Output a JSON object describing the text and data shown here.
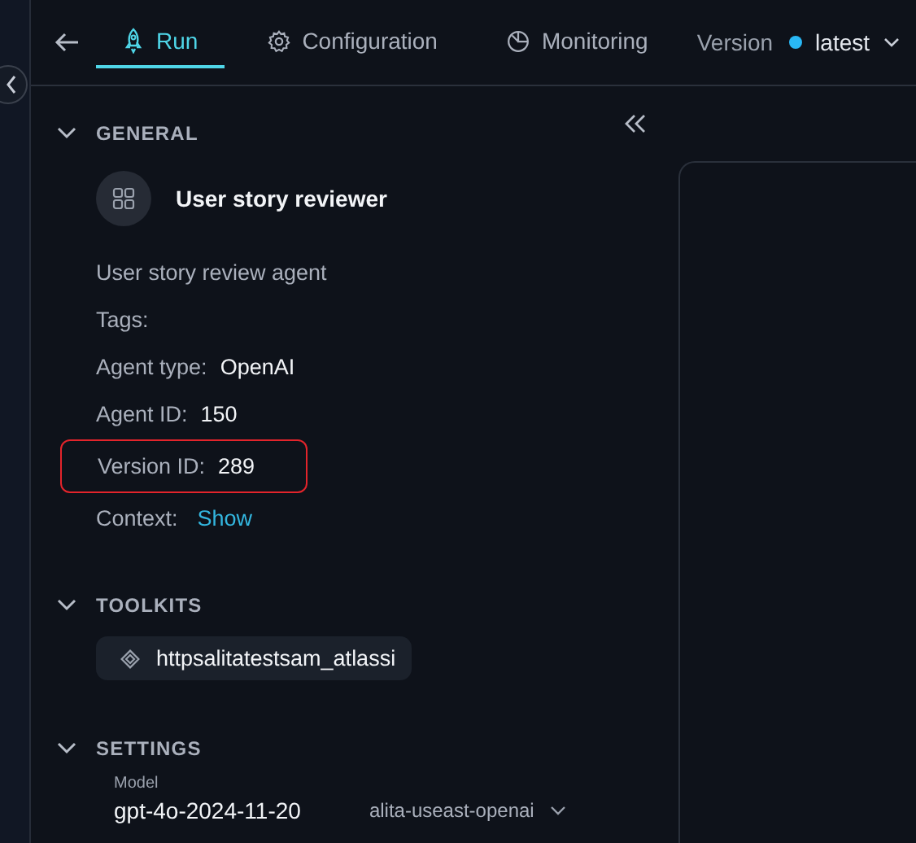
{
  "nav": {
    "tabs": [
      {
        "label": "Run",
        "selected": true
      },
      {
        "label": "Configuration",
        "selected": false
      },
      {
        "label": "Monitoring",
        "selected": false
      }
    ],
    "version_label": "Version",
    "version_value": "latest"
  },
  "general": {
    "title": "GENERAL",
    "agent_name": "User story reviewer",
    "description": "User story review agent",
    "fields": [
      {
        "kind": "pair",
        "label": "Tags:",
        "highlighted": false
      },
      {
        "kind": "pair",
        "label": "Agent type:",
        "value": "OpenAI",
        "highlighted": false
      },
      {
        "kind": "pair",
        "label": "Agent ID:",
        "value": "150",
        "highlighted": false
      },
      {
        "kind": "pair",
        "label": "Version ID:",
        "value": "289",
        "highlighted": true
      },
      {
        "kind": "link",
        "label": "Context:",
        "value": "Show",
        "highlighted": false
      }
    ]
  },
  "toolkits": {
    "title": "TOOLKITS",
    "items": [
      "httpsalitatestsam_atlassi"
    ]
  },
  "settings": {
    "title": "SETTINGS",
    "model_label": "Model",
    "model_value": "gpt-4o-2024-11-20",
    "provider": "alita-useast-openai"
  }
}
